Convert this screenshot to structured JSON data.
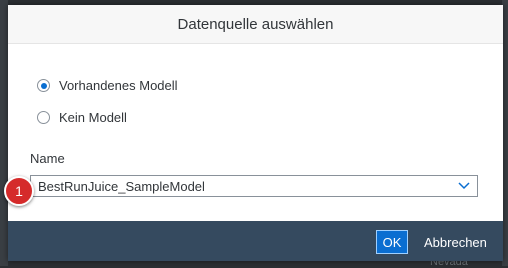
{
  "dialog": {
    "title": "Datenquelle auswählen",
    "options": [
      {
        "label": "Vorhandenes Modell",
        "selected": true
      },
      {
        "label": "Kein Modell",
        "selected": false
      }
    ],
    "name_label": "Name",
    "name_value": "BestRunJuice_SampleModel",
    "ok_label": "OK",
    "cancel_label": "Abbrechen"
  },
  "annotation": {
    "step_number": "1"
  },
  "background": {
    "partial_text": "Nevada"
  },
  "colors": {
    "accent": "#0a6ed1",
    "footer": "#354a5f",
    "badge": "#d52b2b"
  }
}
